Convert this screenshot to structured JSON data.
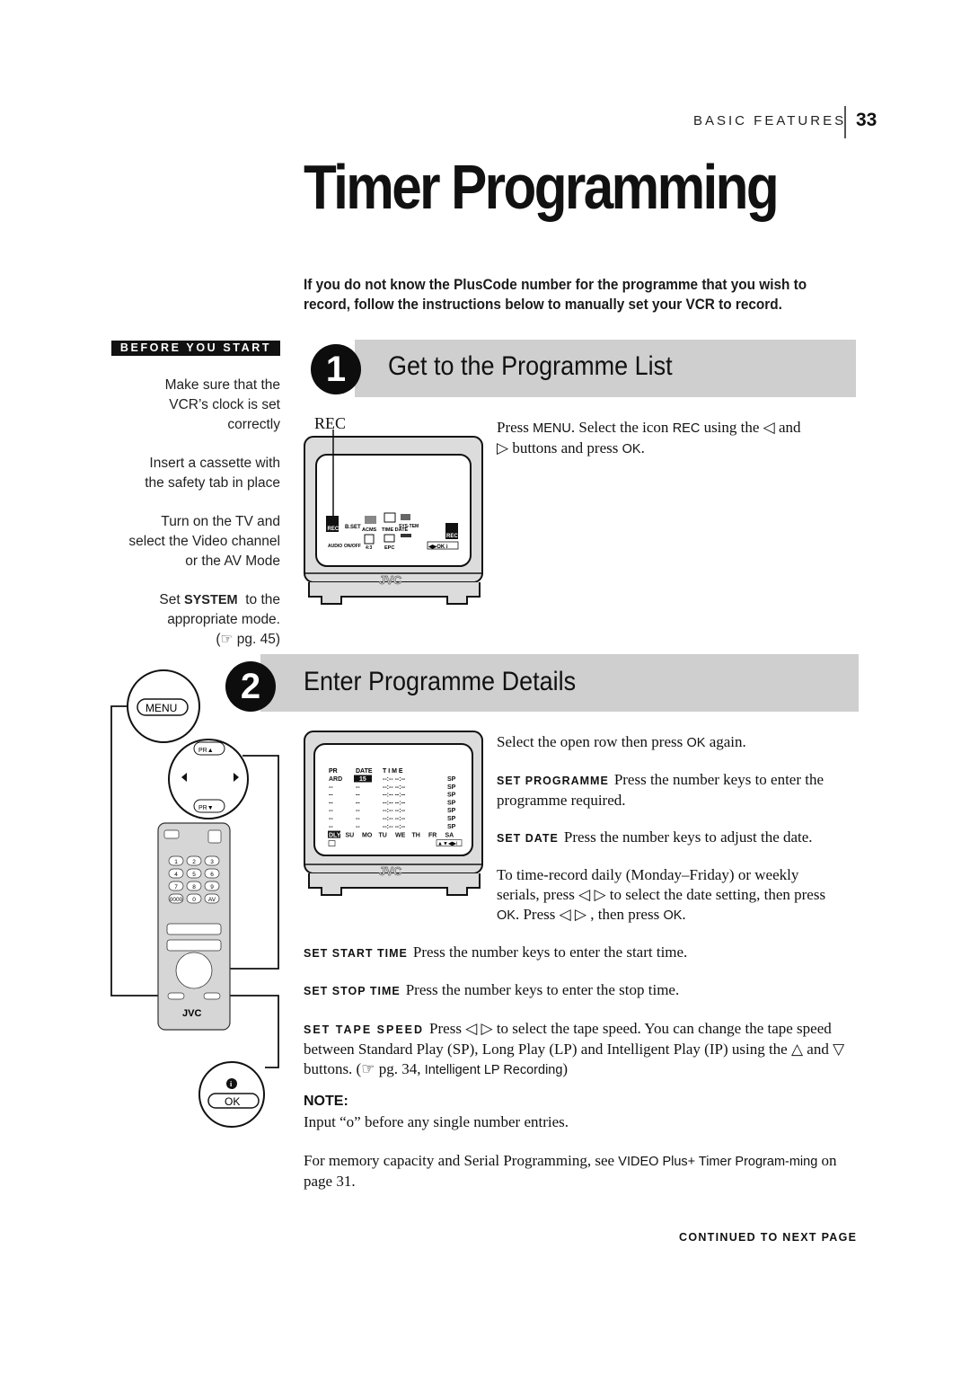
{
  "header": {
    "section": "BASIC FEATURES",
    "page_number": "33"
  },
  "title": "Timer Programming",
  "intro": "If you do not know the PlusCode number for the programme that you wish to record, follow the instructions below to manually set your VCR to record.",
  "sidebar": {
    "badge": "BEFORE YOU START",
    "tips": [
      {
        "lines": [
          "Make sure that the",
          "VCR’s clock is set",
          "correctly"
        ]
      },
      {
        "lines": [
          "Insert a cassette with",
          "the safety tab in place"
        ]
      },
      {
        "lines": [
          "Turn on the TV and",
          "select the Video channel",
          "or the AV Mode"
        ]
      },
      {
        "pre": "Set ",
        "kw": "SYSTEM",
        "post": "  to the",
        "line2": "appropriate mode.",
        "ref": "(☞ pg. 45)"
      }
    ]
  },
  "step1": {
    "number": "1",
    "title": "Get to the Programme List",
    "callout": "REC",
    "text": {
      "a": "Press ",
      "menu": "MENU",
      "b": ". Select the icon ",
      "rec": "REC",
      "c": " using the ◁ and",
      "d": "▷ buttons and press ",
      "ok": "OK",
      "e": "."
    },
    "tv": {
      "brand": "JVC",
      "menu_icons": [
        {
          "label": "REC",
          "selected": true
        },
        {
          "label": "B.SET"
        },
        {
          "label": "ACMS"
        },
        {
          "label": "TIME DATE"
        },
        {
          "label": "SYS-TEM"
        },
        {
          "label": "AUDIO"
        },
        {
          "label": "ON/OFF"
        },
        {
          "label": "4:3"
        },
        {
          "label": "EPC"
        }
      ],
      "corner_label": "REC",
      "nav_hint": "◀▶OK i"
    }
  },
  "step2": {
    "number": "2",
    "title": "Enter Programme Details",
    "remote": {
      "menu_button": "MENU",
      "ok_button": "OK",
      "pr_up": "PR▲",
      "pr_down": "PR▼",
      "brand": "JVC",
      "keys": [
        "1",
        "2",
        "3",
        "4",
        "5",
        "6",
        "7",
        "8",
        "9",
        "0000",
        "0",
        "AV"
      ]
    },
    "tv": {
      "brand": "JVC",
      "headers": [
        "PR",
        "DATE",
        "T  I  M  E",
        ""
      ],
      "rows": [
        [
          "ARD",
          "15",
          "--:-- --:--",
          "SP"
        ],
        [
          "--",
          "--",
          "--:-- --:--",
          "SP"
        ],
        [
          "--",
          "--",
          "--:-- --:--",
          "SP"
        ],
        [
          "--",
          "--",
          "--:-- --:--",
          "SP"
        ],
        [
          "--",
          "--",
          "--:-- --:--",
          "SP"
        ],
        [
          "--",
          "--",
          "--:-- --:--",
          "SP"
        ],
        [
          "--",
          "--",
          "--:-- --:--",
          "SP"
        ]
      ],
      "days": [
        "DLY",
        "SU",
        "MO",
        "TU",
        "WE",
        "TH",
        "FR",
        "SA"
      ],
      "nav_hint": "▲▼◀▶i"
    },
    "select_row": {
      "a": "Select the open row then press ",
      "ok": "OK",
      "b": " again."
    },
    "set_programme": {
      "label": "SET PROGRAMME",
      "text": "Press the number keys to enter the programme required."
    },
    "set_date": {
      "label": "SET DATE",
      "text": "Press the number keys to adjust the date."
    },
    "daily": {
      "a": "To time-record daily (Monday–Friday) or weekly serials, press ◁ ▷ to select the date setting, then press ",
      "ok1": "OK",
      "b": ". Press ◁ ▷ , then press ",
      "ok2": "OK",
      "c": "."
    },
    "set_start": {
      "label": "SET START TIME",
      "text": "Press the number keys to enter the start time."
    },
    "set_stop": {
      "label": "SET STOP TIME",
      "text": "Press the number keys to enter the stop time."
    },
    "set_speed": {
      "label": "SET TAPE SPEED",
      "text": "Press ◁ ▷ to select the tape speed. You can change the tape speed between Standard Play (SP), Long Play (LP) and Intelligent Play (IP) using the △ and ▽ buttons. (☞ pg. 34, ",
      "link": "Intelligent LP Recording",
      "end": ")"
    }
  },
  "note": {
    "heading": "NOTE:",
    "text": "Input “o” before any single number entries."
  },
  "memory": {
    "a": "For memory capacity and Serial Programming, see ",
    "link": "VIDEO Plus+ Timer Program-ming",
    "b": " on page 31."
  },
  "footer": {
    "continued": "CONTINUED TO NEXT PAGE"
  }
}
